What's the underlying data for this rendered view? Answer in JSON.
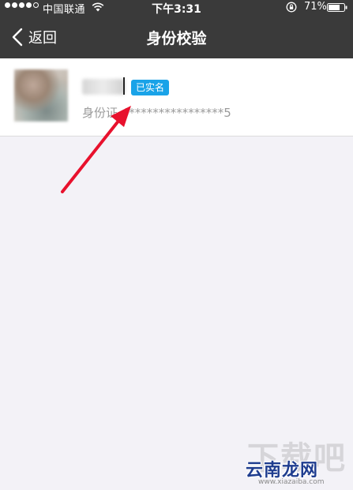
{
  "status_bar": {
    "carrier": "中国联通",
    "time": "下午3:31",
    "battery": "71%"
  },
  "nav": {
    "back_label": "返回",
    "title": "身份校验"
  },
  "identity": {
    "badge": "已实名",
    "id_text": "身份证 4****************5"
  },
  "watermark": {
    "back": "下载吧",
    "brand": "云南龙网",
    "url": "www.xiazaiba.com"
  },
  "colors": {
    "header_bg": "#3a3a3a",
    "badge_bg": "#1aa3e8",
    "arrow": "#e8112d",
    "page_bg": "#f3f2f7"
  }
}
